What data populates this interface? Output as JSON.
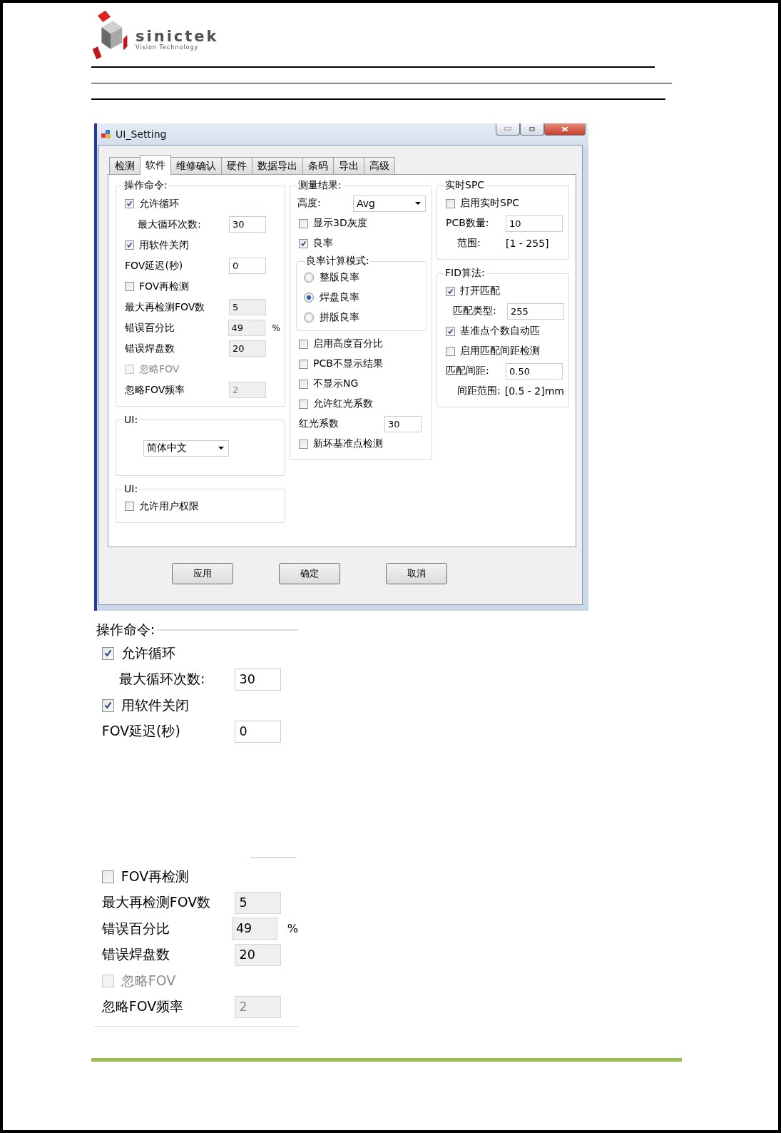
{
  "logo": {
    "brand": "sinictek",
    "tagline": "Vision Technology"
  },
  "window": {
    "title": "UI_Setting",
    "tabs": [
      {
        "label": "检测",
        "selected": false
      },
      {
        "label": "软件",
        "selected": true
      },
      {
        "label": "维修确认",
        "selected": false
      },
      {
        "label": "硬件",
        "selected": false
      },
      {
        "label": "数据导出",
        "selected": false
      },
      {
        "label": "条码",
        "selected": false
      },
      {
        "label": "导出",
        "selected": false
      },
      {
        "label": "高级",
        "selected": false
      }
    ],
    "columns": [
      [
        {
          "title": "操作命令:",
          "rows": [
            {
              "kind": "checkbox",
              "label": "允许循环",
              "checked": true,
              "disabled": false
            },
            {
              "kind": "subfield",
              "label": "最大循环次数:",
              "value": "30",
              "readonly": false,
              "disabled": false
            },
            {
              "kind": "checkbox",
              "label": "用软件关闭",
              "checked": true,
              "disabled": false
            },
            {
              "kind": "field",
              "label": "FOV延迟(秒)",
              "value": "0",
              "readonly": false,
              "disabled": false
            },
            {
              "kind": "checkbox",
              "label": "FOV再检测",
              "checked": false,
              "disabled": false
            },
            {
              "kind": "field",
              "label": "最大再检测FOV数",
              "value": "5",
              "readonly": true,
              "disabled": false
            },
            {
              "kind": "field",
              "label": "错误百分比",
              "value": "49",
              "unit": "%",
              "readonly": true,
              "disabled": false
            },
            {
              "kind": "field",
              "label": "错误焊盘数",
              "value": "20",
              "readonly": true,
              "disabled": false
            },
            {
              "kind": "checkbox",
              "label": "忽略FOV",
              "checked": false,
              "disabled": true
            },
            {
              "kind": "field",
              "label": "忽略FOV频率",
              "value": "2",
              "readonly": true,
              "disabled": true
            }
          ]
        },
        {
          "title": "UI:",
          "rows": [
            {
              "kind": "dropdown",
              "value": "简体中文"
            }
          ]
        },
        {
          "title": "UI:",
          "rows": [
            {
              "kind": "checkbox",
              "label": "允许用户权限",
              "checked": false,
              "disabled": false
            }
          ]
        }
      ],
      [
        {
          "title": "测量结果:",
          "rows": [
            {
              "kind": "select",
              "label": "高度:",
              "value": "Avg"
            },
            {
              "kind": "checkbox",
              "label": "显示3D灰度",
              "checked": false,
              "disabled": false
            },
            {
              "kind": "checkbox",
              "label": "良率",
              "checked": true,
              "disabled": false
            },
            {
              "kind": "radiogroup",
              "label": "良率计算模式:",
              "options": [
                {
                  "label": "整版良率",
                  "selected": false
                },
                {
                  "label": "焊盘良率",
                  "selected": true
                },
                {
                  "label": "拼版良率",
                  "selected": false
                }
              ]
            },
            {
              "kind": "checkbox",
              "label": "启用高度百分比",
              "checked": false,
              "disabled": false
            },
            {
              "kind": "checkbox",
              "label": "PCB不显示结果",
              "checked": false,
              "disabled": false
            },
            {
              "kind": "checkbox",
              "label": "不显示NG",
              "checked": false,
              "disabled": false
            },
            {
              "kind": "checkbox",
              "label": "允许红光系数",
              "checked": false,
              "disabled": false
            },
            {
              "kind": "field",
              "label": "红光系数",
              "value": "30",
              "readonly": false,
              "disabled": false
            },
            {
              "kind": "checkbox",
              "label": "新坏基准点检测",
              "checked": false,
              "disabled": false
            }
          ]
        }
      ],
      [
        {
          "title": "实时SPC",
          "rows": [
            {
              "kind": "checkbox",
              "label": "启用实时SPC",
              "checked": false,
              "disabled": false
            },
            {
              "kind": "field",
              "label": "PCB数量:",
              "value": "10",
              "readonly": false,
              "disabled": false
            },
            {
              "kind": "info",
              "label": "范围:",
              "value": "[1 - 255]"
            }
          ]
        },
        {
          "title": "FID算法:",
          "rows": [
            {
              "kind": "checkbox",
              "label": "打开匹配",
              "checked": true,
              "disabled": false
            },
            {
              "kind": "subfield",
              "label": "匹配类型:",
              "value": "255",
              "readonly": false,
              "disabled": false
            },
            {
              "kind": "checkbox",
              "label": "基准点个数自动匹",
              "checked": true,
              "disabled": false
            },
            {
              "kind": "checkbox",
              "label": "启用匹配间距检测",
              "checked": false,
              "disabled": false
            },
            {
              "kind": "field",
              "label": "匹配间距:",
              "value": "0.50",
              "readonly": false,
              "disabled": false
            },
            {
              "kind": "info",
              "label": "间距范围:",
              "value": "[0.5 - 2]mm"
            }
          ]
        }
      ]
    ],
    "buttons": [
      "应用",
      "确定",
      "取消"
    ]
  },
  "zoomed_crop": {
    "title": "操作命令:",
    "rows_top": [
      {
        "kind": "checkbox",
        "label": "允许循环",
        "checked": true,
        "disabled": false
      },
      {
        "kind": "subfield",
        "label": "最大循环次数:",
        "value": "30",
        "readonly": false,
        "disabled": false
      },
      {
        "kind": "checkbox",
        "label": "用软件关闭",
        "checked": true,
        "disabled": false
      },
      {
        "kind": "field",
        "label": "FOV延迟(秒)",
        "value": "0",
        "readonly": false,
        "disabled": false
      }
    ],
    "rows_bottom": [
      {
        "kind": "checkbox",
        "label": "FOV再检测",
        "checked": false,
        "disabled": false
      },
      {
        "kind": "field",
        "label": "最大再检测FOV数",
        "value": "5",
        "readonly": true,
        "disabled": false
      },
      {
        "kind": "field",
        "label": "错误百分比",
        "value": "49",
        "unit": "%",
        "readonly": true,
        "disabled": false
      },
      {
        "kind": "field",
        "label": "错误焊盘数",
        "value": "20",
        "readonly": true,
        "disabled": false
      },
      {
        "kind": "checkbox",
        "label": "忽略FOV",
        "checked": false,
        "disabled": true
      },
      {
        "kind": "field",
        "label": "忽略FOV频率",
        "value": "2",
        "readonly": true,
        "disabled": true
      }
    ]
  }
}
